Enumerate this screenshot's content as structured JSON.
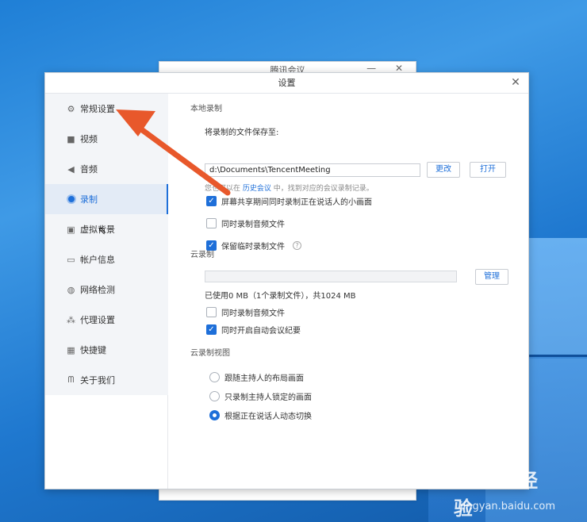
{
  "back_window": {
    "title": "腾讯会议",
    "controls": "— ✕"
  },
  "dialog": {
    "title": "设置",
    "close": "✕"
  },
  "sidebar": {
    "items": [
      {
        "label": "常规设置",
        "icon": "gear-icon",
        "glyph": "⚙"
      },
      {
        "label": "视频",
        "icon": "camera-icon",
        "glyph": "■"
      },
      {
        "label": "音频",
        "icon": "speaker-icon",
        "glyph": "◀"
      },
      {
        "label": "录制",
        "icon": "record-icon",
        "glyph": "●",
        "active": true
      },
      {
        "label": "虚拟背景",
        "icon": "person-icon",
        "glyph": "▣"
      },
      {
        "label": "帐户信息",
        "icon": "card-icon",
        "glyph": "▭"
      },
      {
        "label": "网络检测",
        "icon": "globe-icon",
        "glyph": "◍"
      },
      {
        "label": "代理设置",
        "icon": "network-icon",
        "glyph": "⁂"
      },
      {
        "label": "快捷键",
        "icon": "keyboard-icon",
        "glyph": "▦"
      },
      {
        "label": "关于我们",
        "icon": "logo-icon",
        "glyph": "ᗰ"
      }
    ]
  },
  "local_recording": {
    "section_title": "本地录制",
    "save_to_label": "将录制的文件保存至:",
    "path": "d:\\Documents\\TencentMeeting",
    "change_button": "更改",
    "open_button": "打开",
    "hint_prefix": "您也可以在",
    "hint_link": "历史会议",
    "hint_suffix": "中，找到对应的会议录制记录。",
    "options": [
      {
        "label": "屏幕共享期间同时录制正在说话人的小画面",
        "checked": true
      },
      {
        "label": "同时录制音频文件",
        "checked": false
      },
      {
        "label": "保留临时录制文件",
        "checked": true
      }
    ],
    "help": "?"
  },
  "cloud_recording": {
    "section_title": "云录制",
    "usage_text": "已使用0 MB（1个录制文件），共1024 MB",
    "usage_fraction": 0,
    "manage_button": "管理",
    "options": [
      {
        "label": "同时录制音频文件",
        "checked": false
      },
      {
        "label": "同时开启自动会议纪要",
        "checked": true
      }
    ]
  },
  "cloud_view": {
    "section_title": "云录制视图",
    "options": [
      {
        "label": "跟随主持人的布局画面",
        "selected": false
      },
      {
        "label": "只录制主持人锁定的画面",
        "selected": false
      },
      {
        "label": "根据正在说话人动态切换",
        "selected": true
      }
    ]
  },
  "watermark": {
    "brand": "Baidu经验",
    "site": "jingyan.baidu.com"
  },
  "colors": {
    "accent": "#1e6fd9",
    "arrow": "#e8582b",
    "desktop": "#1f7fd6"
  }
}
